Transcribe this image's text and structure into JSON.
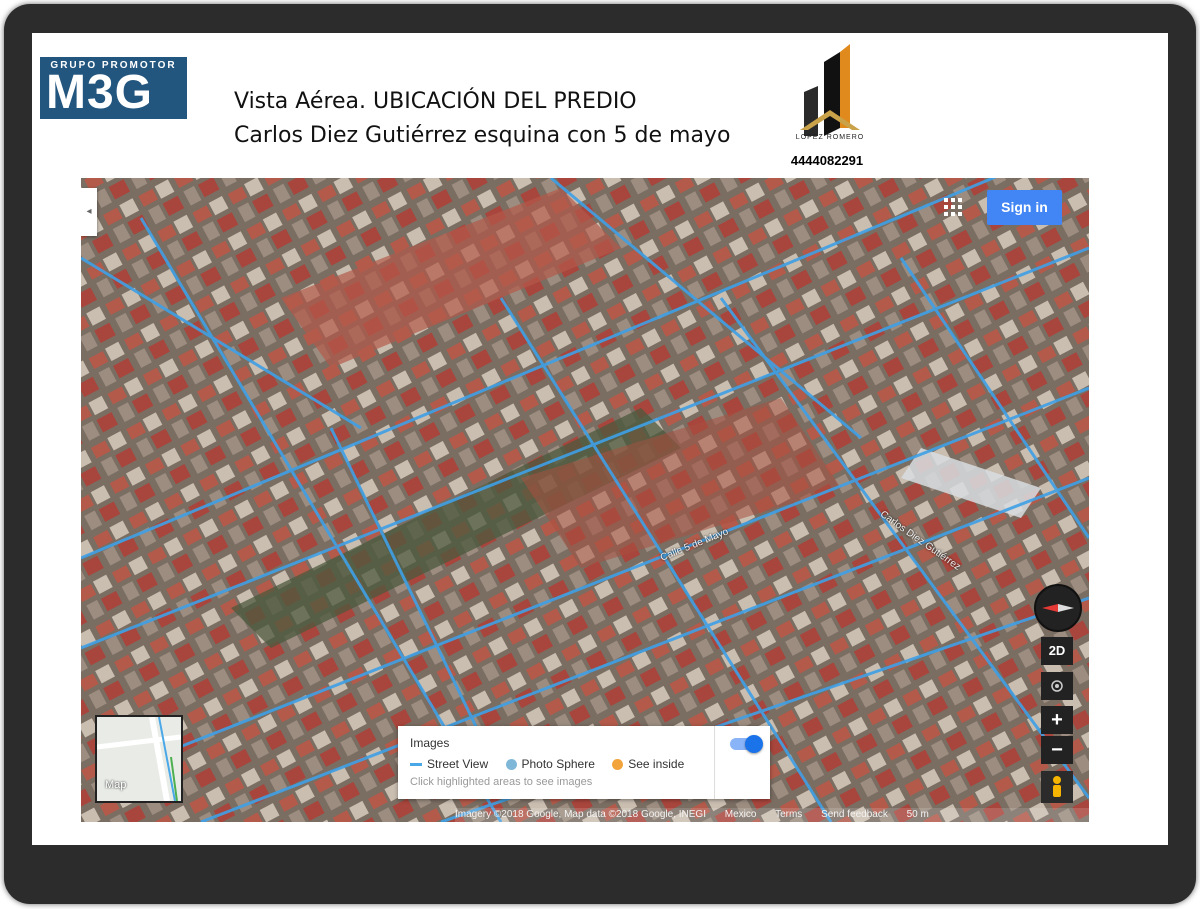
{
  "logo": {
    "top_text": "GRUPO PROMOTOR",
    "main_text": "M3G",
    "bg_color": "#23567f"
  },
  "heading": {
    "line1": "Vista Aérea.  UBICACIÓN DEL PREDIO",
    "line2": "Carlos Diez Gutiérrez esquina con 5 de mayo"
  },
  "agency": {
    "name": "LOPEZ ROMERO",
    "phone": "4444082291",
    "accent_color": "#e08a1e"
  },
  "map": {
    "sign_in_label": "Sign in",
    "view_mode_button": "2D",
    "zoom_in_label": "+",
    "zoom_out_label": "−",
    "minimap_label": "Map",
    "legend": {
      "title": "Images",
      "items": [
        {
          "label": "Street View",
          "icon": "street-view-line-icon",
          "color": "#4aa8e8"
        },
        {
          "label": "Photo Sphere",
          "icon": "photo-sphere-dot-icon",
          "color": "#7fb7d8"
        },
        {
          "label": "See inside",
          "icon": "see-inside-dot-icon",
          "color": "#f2a33a"
        }
      ],
      "hint": "Click highlighted areas to see images",
      "toggle_on": true
    },
    "street_labels": [
      "Calle 5 de Mayo",
      "Carlos Diez Gutiérrez"
    ],
    "footer": {
      "attribution": "Imagery ©2018 Google, Map data ©2018 Google, INEGI",
      "country": "Mexico",
      "terms": "Terms",
      "feedback": "Send feedback",
      "scale": "50 m"
    }
  }
}
